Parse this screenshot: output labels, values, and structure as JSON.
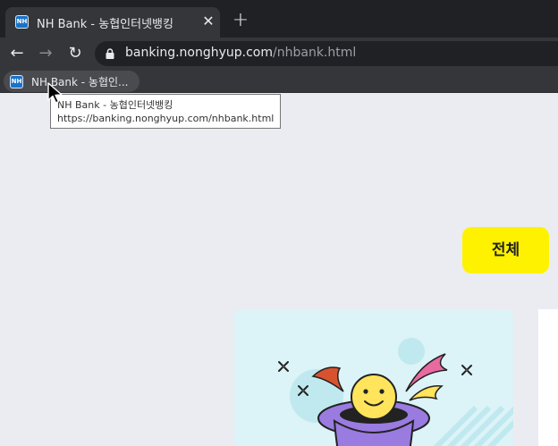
{
  "browser": {
    "tab": {
      "favicon_text": "NH",
      "title": "NH Bank - 농협인터넷뱅킹",
      "close_glyph": "✕"
    },
    "new_tab_glyph": "+",
    "toolbar": {
      "back_glyph": "←",
      "forward_glyph": "→",
      "reload_glyph": "↻",
      "url_host": "banking.nonghyup.com",
      "url_path": "/nhbank.html"
    },
    "bookmark": {
      "favicon_text": "NH",
      "label": "NH Bank - 농협인..."
    },
    "tooltip": {
      "line1": "NH Bank - 농협인터넷뱅킹",
      "line2": "https://banking.nonghyup.com/nhbank.html"
    }
  },
  "page": {
    "filter_button_label": "전체",
    "colors": {
      "accent_yellow": "#fff200",
      "card_background": "#dcf3f8",
      "page_background": "#ebecf1",
      "hat_purple": "#9a7be0",
      "face_yellow": "#ffe45c",
      "ribbon_pink": "#e86aa0",
      "ribbon_red": "#d9522e"
    },
    "illustration_icons": [
      "sparkle-icon",
      "magic-hat-icon",
      "smiley-face-icon",
      "confetti-icon"
    ]
  }
}
